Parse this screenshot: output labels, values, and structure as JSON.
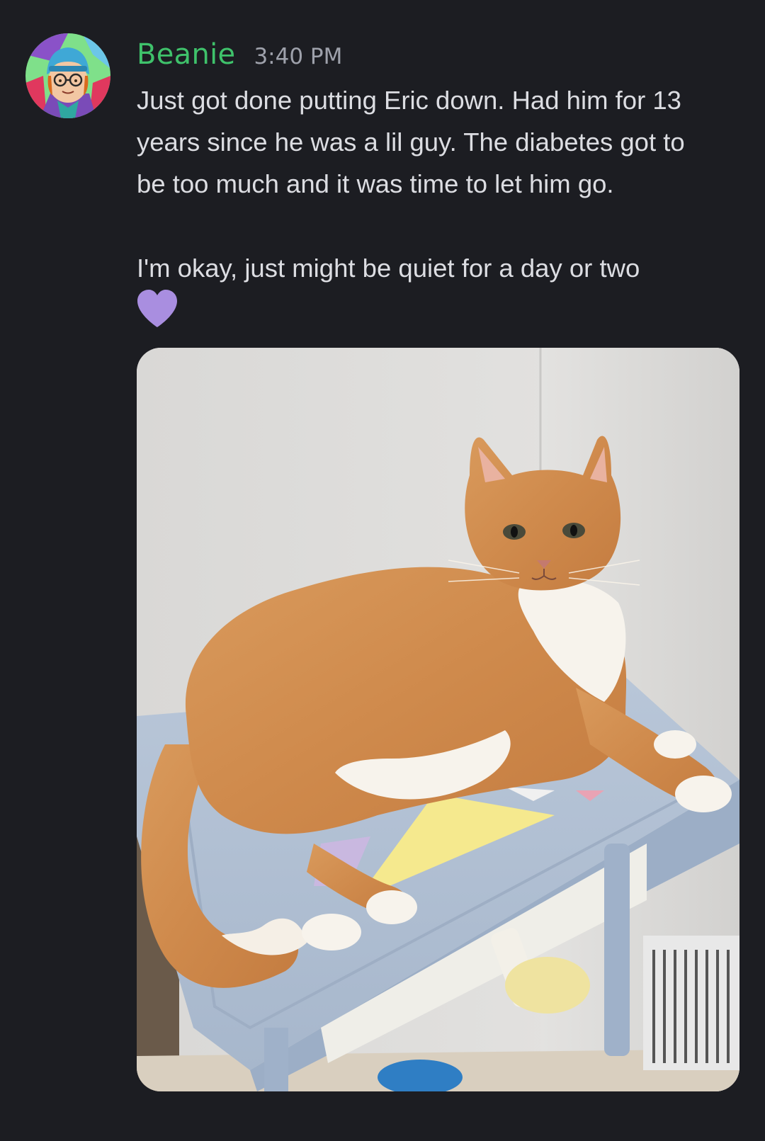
{
  "message": {
    "author": "Beanie",
    "timestamp": "3:40 PM",
    "paragraphs": [
      [
        "Just got done putting Eric down. Had him for 13",
        "years since he was a lil guy. The diabetes got to",
        "be too much and it was time to let him go."
      ],
      [
        "I'm okay, just might be quiet for a day or two"
      ]
    ],
    "emoji": "purple-heart-icon",
    "attachment": {
      "kind": "photo",
      "subject": "orange tabby cat lying on a light blue side table"
    }
  },
  "colors": {
    "background": "#1c1d22",
    "username": "#3fc26b",
    "timestamp": "#9ea1ab",
    "text": "#dcdde2",
    "heart": "#a98ee0"
  }
}
